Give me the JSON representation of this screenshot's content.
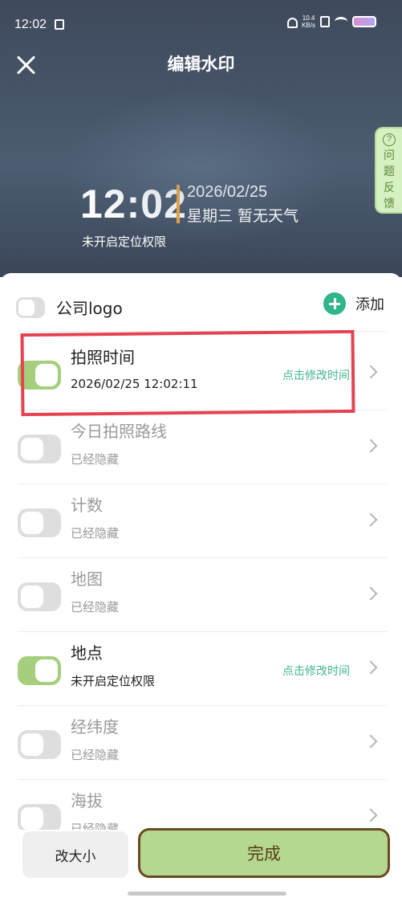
{
  "status_bar": {
    "time": "12:02",
    "network_speed": "10.4",
    "network_unit": "KB/s"
  },
  "header": {
    "title": "编辑水印"
  },
  "feedback": {
    "label": "问题反馈"
  },
  "watermark_preview": {
    "time": "12:02",
    "date": "2026/02/25",
    "weekday_weather": "星期三  暂无天气",
    "location": "未开启定位权限",
    "accent_color": "#f1a33a"
  },
  "logo_row": {
    "label": "公司logo",
    "enabled": false,
    "add_label": "添加"
  },
  "items": [
    {
      "title": "拍照时间",
      "subtitle": "2026/02/25 12:02:11",
      "action": "点击修改时间",
      "enabled": true,
      "muted": false
    },
    {
      "title": "今日拍照路线",
      "subtitle": "已经隐藏",
      "action": "",
      "enabled": false,
      "muted": true
    },
    {
      "title": "计数",
      "subtitle": "已经隐藏",
      "action": "",
      "enabled": false,
      "muted": true
    },
    {
      "title": "地图",
      "subtitle": "已经隐藏",
      "action": "",
      "enabled": false,
      "muted": true
    },
    {
      "title": "地点",
      "subtitle": "未开启定位权限",
      "action": "点击修改时间",
      "enabled": true,
      "muted": false
    },
    {
      "title": "经纬度",
      "subtitle": "已经隐藏",
      "action": "",
      "enabled": false,
      "muted": true
    },
    {
      "title": "海拔",
      "subtitle": "已经隐藏",
      "action": "",
      "enabled": false,
      "muted": true
    }
  ],
  "footer": {
    "resize_label": "改大小",
    "done_label": "完成"
  },
  "colors": {
    "toggle_on": "#a5cf7c",
    "action_text": "#42b58f",
    "highlight": "#e54351",
    "done_button": "#b3d890"
  }
}
